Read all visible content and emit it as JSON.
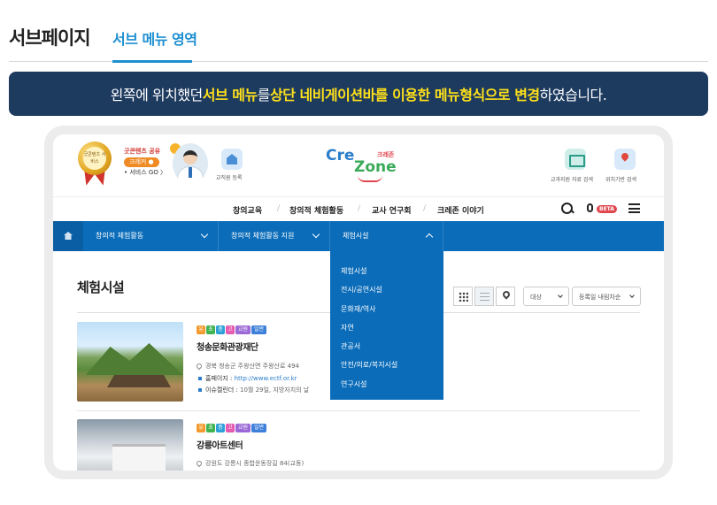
{
  "tabs": {
    "main": "서브페이지",
    "sub": "서브 메뉴 영역"
  },
  "banner": {
    "p1": "왼쪽에 위치했던 ",
    "h1": "서브 메뉴",
    "p2": "를 ",
    "h2": "상단 네비게이션바를 이용한 메뉴형식으로 변경",
    "p3": " 하였습니다."
  },
  "header": {
    "medal_text": "굿콘텐츠 서비스",
    "share_title": "굿콘텐츠 공유",
    "share_btn": "크레커 ●",
    "share_go": "• 서비스 GO 〉",
    "teacher_label": "교직원 등록",
    "logo": {
      "cre": "Cre",
      "zone": "Zone",
      "kor": "크레존"
    },
    "tools": [
      "교과지원 자료 검색",
      "위치기반 검색"
    ]
  },
  "gnb": {
    "items": [
      "창의교육",
      "창의적 체험활동",
      "교사 연구회",
      "크레존 이야기"
    ],
    "beta": "BETA"
  },
  "subnav": {
    "items": [
      "창의적 체험활동",
      "창의적 체험활동 지원",
      "체험시설"
    ]
  },
  "dropdown": {
    "items": [
      "체험시설",
      "전시/공연시설",
      "문화재/역사",
      "자연",
      "관공서",
      "안전/의료/복지시설",
      "연구시설"
    ]
  },
  "content": {
    "title": "체험시설",
    "select1": "대상",
    "select2": "등록일 내림차순",
    "badge_colors": [
      "#f29a2e",
      "#3fb34f",
      "#2ca0d8",
      "#e45bb0",
      "#9b6ad6",
      "#3d7fd9"
    ],
    "badges": [
      "유",
      "초",
      "중",
      "고",
      "교원",
      "일반"
    ],
    "items": [
      {
        "title": "청송문화관광재단",
        "address": "경북 청송군 주왕산면 주왕산로 494",
        "homepage_label": "홈페이지 : ",
        "homepage": "http://www.ectf.or.kr",
        "issue_label": "이슈캘린더 : ",
        "issue": "10월 29일, 지방자치의 날"
      },
      {
        "title": "강릉아트센터",
        "address": "강원도 강릉시 종합운동장길 84(교동)"
      }
    ]
  }
}
